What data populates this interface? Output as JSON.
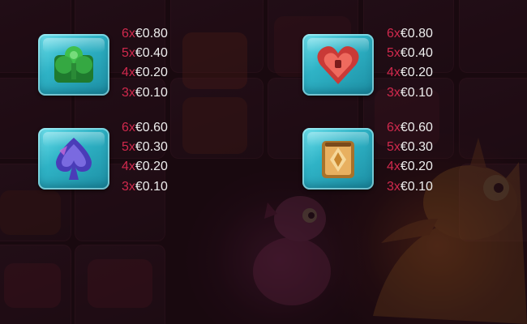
{
  "paytable": [
    {
      "symbol": "clover-gem-icon",
      "color": "#2fa83b",
      "rows": [
        {
          "mult": "6x",
          "amount": "€0.80"
        },
        {
          "mult": "5x",
          "amount": "€0.40"
        },
        {
          "mult": "4x",
          "amount": "€0.20"
        },
        {
          "mult": "3x",
          "amount": "€0.10"
        }
      ]
    },
    {
      "symbol": "heart-gem-icon",
      "color": "#d8403d",
      "rows": [
        {
          "mult": "6x",
          "amount": "€0.80"
        },
        {
          "mult": "5x",
          "amount": "€0.40"
        },
        {
          "mult": "4x",
          "amount": "€0.20"
        },
        {
          "mult": "3x",
          "amount": "€0.10"
        }
      ]
    },
    {
      "symbol": "spade-gem-icon",
      "color": "#5546c8",
      "rows": [
        {
          "mult": "6x",
          "amount": "€0.60"
        },
        {
          "mult": "5x",
          "amount": "€0.30"
        },
        {
          "mult": "4x",
          "amount": "€0.20"
        },
        {
          "mult": "3x",
          "amount": "€0.10"
        }
      ]
    },
    {
      "symbol": "diamond-gem-icon",
      "color": "#d69a3c",
      "rows": [
        {
          "mult": "6x",
          "amount": "€0.60"
        },
        {
          "mult": "5x",
          "amount": "€0.30"
        },
        {
          "mult": "4x",
          "amount": "€0.20"
        },
        {
          "mult": "3x",
          "amount": "€0.10"
        }
      ]
    }
  ],
  "colors": {
    "multiplier": "#d0294d",
    "amount": "#eeeeee",
    "ice_frame": "#3cc0d0",
    "background": "#1e0b13"
  }
}
